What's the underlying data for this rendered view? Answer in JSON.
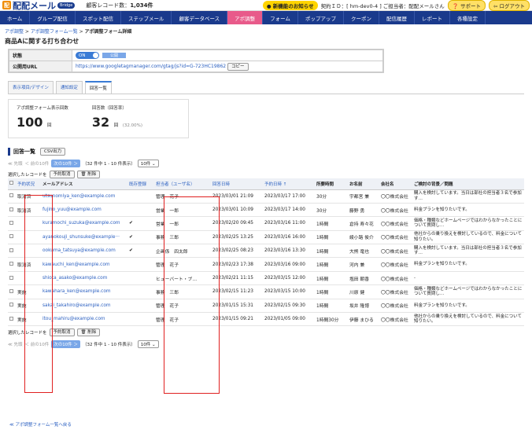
{
  "header": {
    "logo_text": "配配メール",
    "logo_badge": "Bridge",
    "record_label": "顧客レコード数：",
    "record_count": "1,034件",
    "notice": "● 新機能のお知らせ",
    "account": "契約ＩＤ：[ hm-dev0-4 ] ご担当者：配配メールさん",
    "support": "❓ サポート",
    "logout": "⇦ ログアウト"
  },
  "nav": [
    "ホーム",
    "グループ配信",
    "スポット配信",
    "ステップメール",
    "顧客データベース",
    "アポ調整",
    "フォーム",
    "ポップアップ",
    "クーポン",
    "配信履歴",
    "レポート",
    "各種設定"
  ],
  "breadcrumb": {
    "a": "アポ調整",
    "sep1": " > ",
    "b": "アポ調整フォーム一覧",
    "sep2": " > ",
    "c": "アポ調整フォーム詳細"
  },
  "page_title": "商品Aに関する打ち合わせ",
  "info": {
    "status_label": "状態",
    "status_on": "ON",
    "status_bar": "公開",
    "url_label": "公開用URL",
    "url": "https://www.googletagmanager.com/gtag/js?id=G-723HC19862",
    "copy": "コピー"
  },
  "tabs": [
    "表示項目/デザイン",
    "通知設定",
    "回答一覧"
  ],
  "stats": {
    "views_label": "アポ調整フォーム表示回数",
    "views": "100",
    "views_unit": "回",
    "answers_label": "回答数（回答率）",
    "answers": "32",
    "answers_unit": "回",
    "rate": "(32.00%)"
  },
  "section": {
    "title": "回答一覧",
    "csv": "CSV出力"
  },
  "pager": {
    "first": "≪ 先頭",
    "prev": "＜ 前の10件",
    "next": "次の10件 ＞",
    "range": "（32 件中 1 - 10 件表示）",
    "size": "10件 ⌄"
  },
  "ops": {
    "label": "選択したレコードを",
    "reserve": "予約取消",
    "delete": "🗑 削除"
  },
  "columns": [
    "予約状況",
    "メールアドレス",
    "既存登録",
    "担当者（ユーザ名）",
    "回答日時",
    "予約日時 ↑",
    "所要時間",
    "お名前",
    "会社名",
    "ご検討の背景／問題"
  ],
  "rows": [
    [
      "取消済",
      "utsunomiya_ken@example.com",
      "",
      "管理　花子",
      "2023/03/01 21:09",
      "2023/03/17 17:00",
      "30分",
      "宇都宮 兼",
      "〇〇株式会社",
      "購入を検討しています。当日は部社の担当者３名で参加す…"
    ],
    [
      "取消済",
      "fujino_yuu@example.com",
      "",
      "営業　一郎",
      "2023/03/01 10:09",
      "2023/03/17 14:00",
      "30分",
      "藤野 勇",
      "〇〇株式会社",
      "料金プランを知りたいです。"
    ],
    [
      "",
      "kuramochi_suzuka@example.com",
      "✔",
      "営業　一郎",
      "2023/02/20 09:45",
      "2023/03/16 11:00",
      "1時間",
      "倉持 寿々花",
      "〇〇株式会社",
      "価格・種類などホームページではわからなかったことについて質問し…"
    ],
    [
      "",
      "ayanokouji_shunsuke@example···",
      "✔",
      "事務　三郎",
      "2023/02/25 13:25",
      "2023/03/16 16:00",
      "1時間",
      "綾小路 俊介",
      "〇〇株式会社",
      "他社からの乗り換えを検討しているので、料金について知りたい。"
    ],
    [
      "",
      "ookuma_tatsuya@example.com",
      "✔",
      "企画係　四太郎",
      "2023/02/25 08:23",
      "2023/03/16 13:30",
      "1時間",
      "大熊 竜也",
      "〇〇株式会社",
      "購入を検討しています。当日は部社の担当者３名で参加す…"
    ],
    [
      "取消済",
      "kawauchi_ken@example.com",
      "",
      "管理　花子",
      "2023/02/23 17:38",
      "2023/03/16 09:00",
      "1時間",
      "河内 兼",
      "〇〇株式会社",
      "料金プランを知りたいです。"
    ],
    [
      "",
      "shiota_asako@example.com",
      "",
      "ヒューバート・ブ…",
      "2023/02/21 11:15",
      "2023/03/15 12:00",
      "1時間",
      "塩田 朝香",
      "〇〇株式会社",
      "-"
    ],
    [
      "実施",
      "kawahara_ken@example.com",
      "",
      "事務　三郎",
      "2023/02/15 11:23",
      "2023/03/15 10:00",
      "1時間",
      "川原 健",
      "〇〇株式会社",
      "価格・種類などホームページではわからなかったことについて質問し…"
    ],
    [
      "実施",
      "sakai_takahiro@example.com",
      "",
      "管理　花子",
      "2023/01/15 15:31",
      "2023/02/15 09:30",
      "1時間",
      "坂井 隆博",
      "〇〇株式会社",
      "料金プランを知りたいです。"
    ],
    [
      "実施",
      "itou_mahiru@example.com",
      "",
      "管理　花子",
      "2023/01/15 09:21",
      "2023/01/05 09:00",
      "1時間30分",
      "伊藤 まひる",
      "〇〇株式会社",
      "他社からの乗り換えを検討しているので、料金について知りたい。"
    ]
  ],
  "back_link": "≪ アポ調整フォーム一覧へ戻る"
}
